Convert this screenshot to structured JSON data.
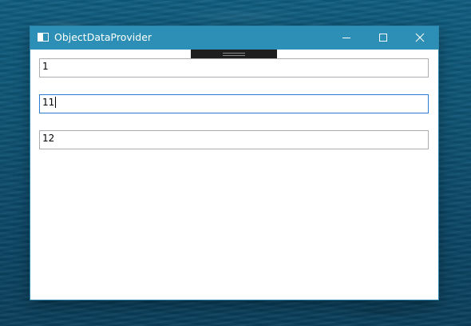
{
  "window": {
    "title": "ObjectDataProvider",
    "icon": "window-app-icon",
    "title_bar_color": "#2d8fb5",
    "controls": {
      "minimize_icon": "minimize-icon",
      "maximize_icon": "maximize-icon",
      "close_icon": "close-icon"
    }
  },
  "textboxes": [
    {
      "value": "1",
      "focused": false
    },
    {
      "value": "11",
      "focused": true
    },
    {
      "value": "12",
      "focused": false
    }
  ],
  "colors": {
    "focus_border": "#2d7bd4",
    "default_border": "#abadb3"
  }
}
